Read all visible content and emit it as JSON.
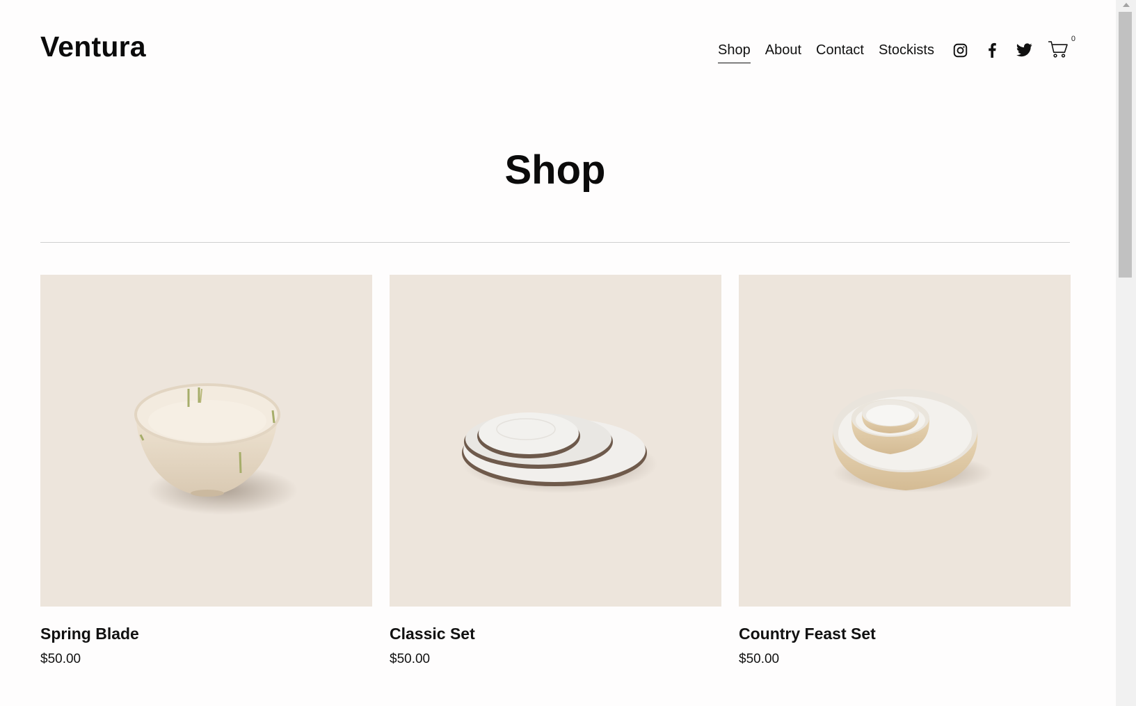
{
  "site": {
    "logo": "Ventura"
  },
  "nav": {
    "links": [
      {
        "label": "Shop",
        "active": true
      },
      {
        "label": "About",
        "active": false
      },
      {
        "label": "Contact",
        "active": false
      },
      {
        "label": "Stockists",
        "active": false
      }
    ],
    "social_icons": [
      "instagram-icon",
      "facebook-icon",
      "twitter-icon"
    ],
    "cart": {
      "icon": "cart-icon",
      "count": "0"
    }
  },
  "main": {
    "title": "Shop",
    "products": [
      {
        "name": "Spring Blade",
        "price": "$50.00",
        "image": "speckled-bowl-with-green-drips"
      },
      {
        "name": "Classic Set",
        "price": "$50.00",
        "image": "stacked-white-plates"
      },
      {
        "name": "Country Feast Set",
        "price": "$50.00",
        "image": "nested-bowls"
      }
    ]
  },
  "colors": {
    "background": "#fefdfd",
    "product_backdrop": "#ede5dc",
    "text": "#111111",
    "divider": "#cfcfcf"
  }
}
